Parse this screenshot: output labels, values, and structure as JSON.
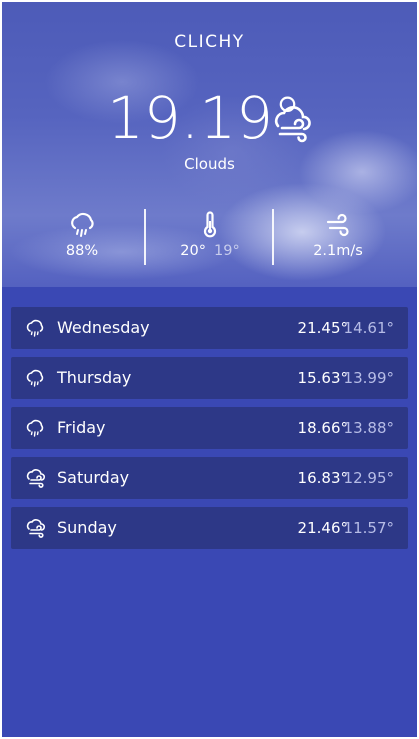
{
  "location": {
    "city": "CLICHY"
  },
  "current": {
    "temperature": "19.19°",
    "description": "Clouds",
    "icon": "cloud-wind-icon"
  },
  "stats": {
    "humidity": {
      "icon": "cloud-rain-icon",
      "value": "88%"
    },
    "temp_range": {
      "icon": "thermometer-icon",
      "high": "20°",
      "low": "19°"
    },
    "wind": {
      "icon": "wind-icon",
      "value": "2.1m/s"
    }
  },
  "forecast": [
    {
      "day": "Wednesday",
      "high": "21.45°",
      "low": "14.61°",
      "icon": "cloud-rain-icon"
    },
    {
      "day": "Thursday",
      "high": "15.63°",
      "low": "13.99°",
      "icon": "cloud-rain-icon"
    },
    {
      "day": "Friday",
      "high": "18.66°",
      "low": "13.88°",
      "icon": "cloud-rain-icon"
    },
    {
      "day": "Saturday",
      "high": "16.83°",
      "low": "12.95°",
      "icon": "cloud-wind-icon"
    },
    {
      "day": "Sunday",
      "high": "21.46°",
      "low": "11.57°",
      "icon": "cloud-wind-icon"
    }
  ],
  "colors": {
    "background": "#3a48b4",
    "card": "#2d3887",
    "low_temp": "#b6bce6",
    "text": "#ffffff"
  }
}
